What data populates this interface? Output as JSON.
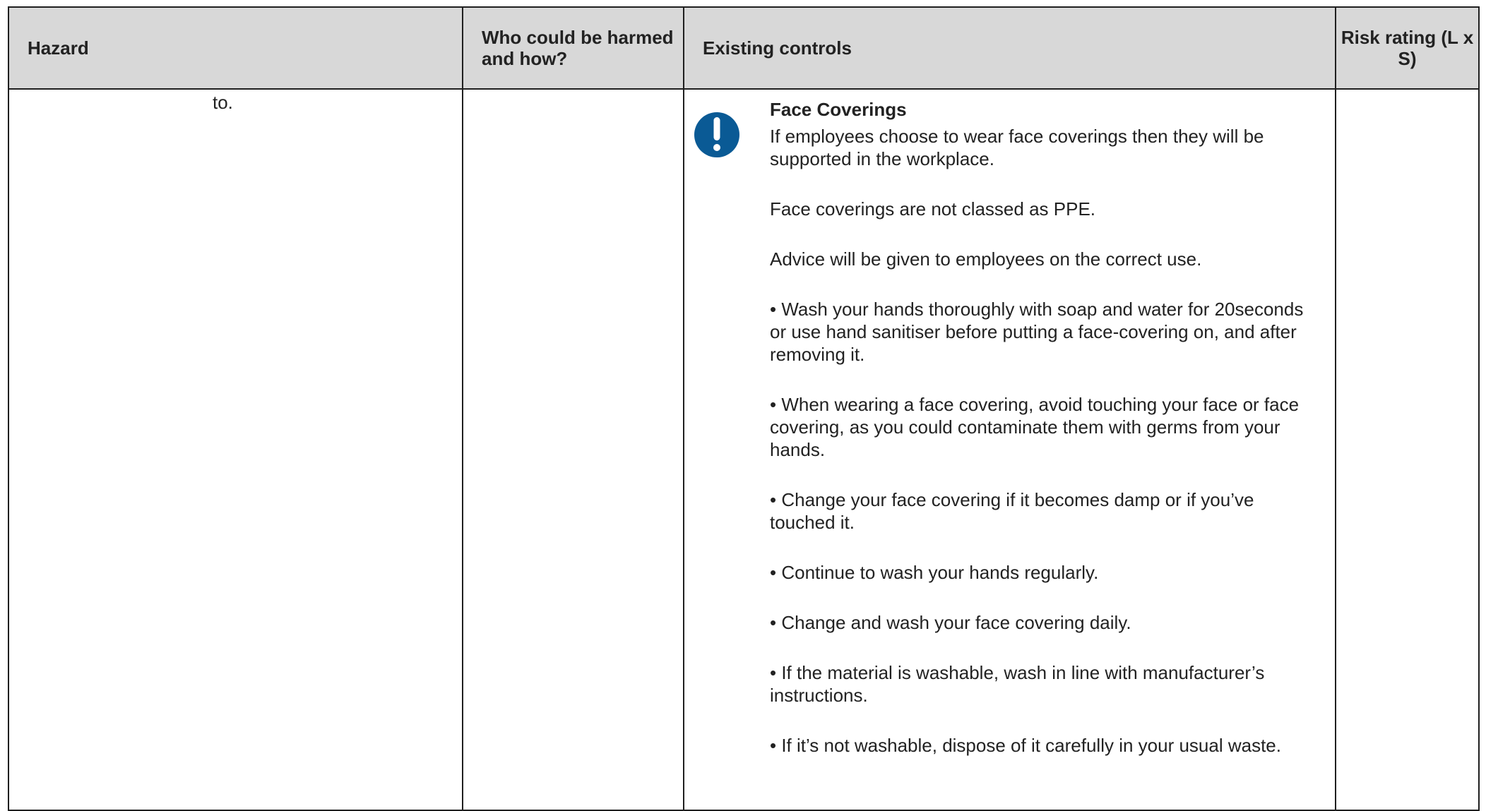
{
  "table": {
    "headers": {
      "hazard": "Hazard",
      "who": "Who could be harmed and how?",
      "controls": "Existing controls",
      "risk": "Risk rating (L x S)"
    },
    "row": {
      "hazard_text": "to.",
      "who_text": "",
      "risk_text": "",
      "controls": {
        "icon": "exclamation-icon",
        "icon_color": "#0a5a95",
        "title": "Face Coverings",
        "paragraphs": [
          "If employees choose to wear face coverings then they will be supported in the workplace.",
          "Face coverings are not classed as PPE.",
          "Advice will be given to employees on the correct use.",
          "• Wash your hands thoroughly with soap and water for 20seconds or use hand sanitiser before putting a face-covering on, and after removing it.",
          "• When wearing a face covering, avoid touching your face or face covering, as you could contaminate them with germs from your hands.",
          "• Change your face covering if it becomes damp or if you’ve touched it.",
          "• Continue to wash your hands regularly.",
          "• Change and wash your face covering daily.",
          "• If the material is washable, wash in line with manufacturer’s instructions.",
          "• If it’s not washable, dispose of it carefully in your usual waste."
        ]
      }
    }
  }
}
